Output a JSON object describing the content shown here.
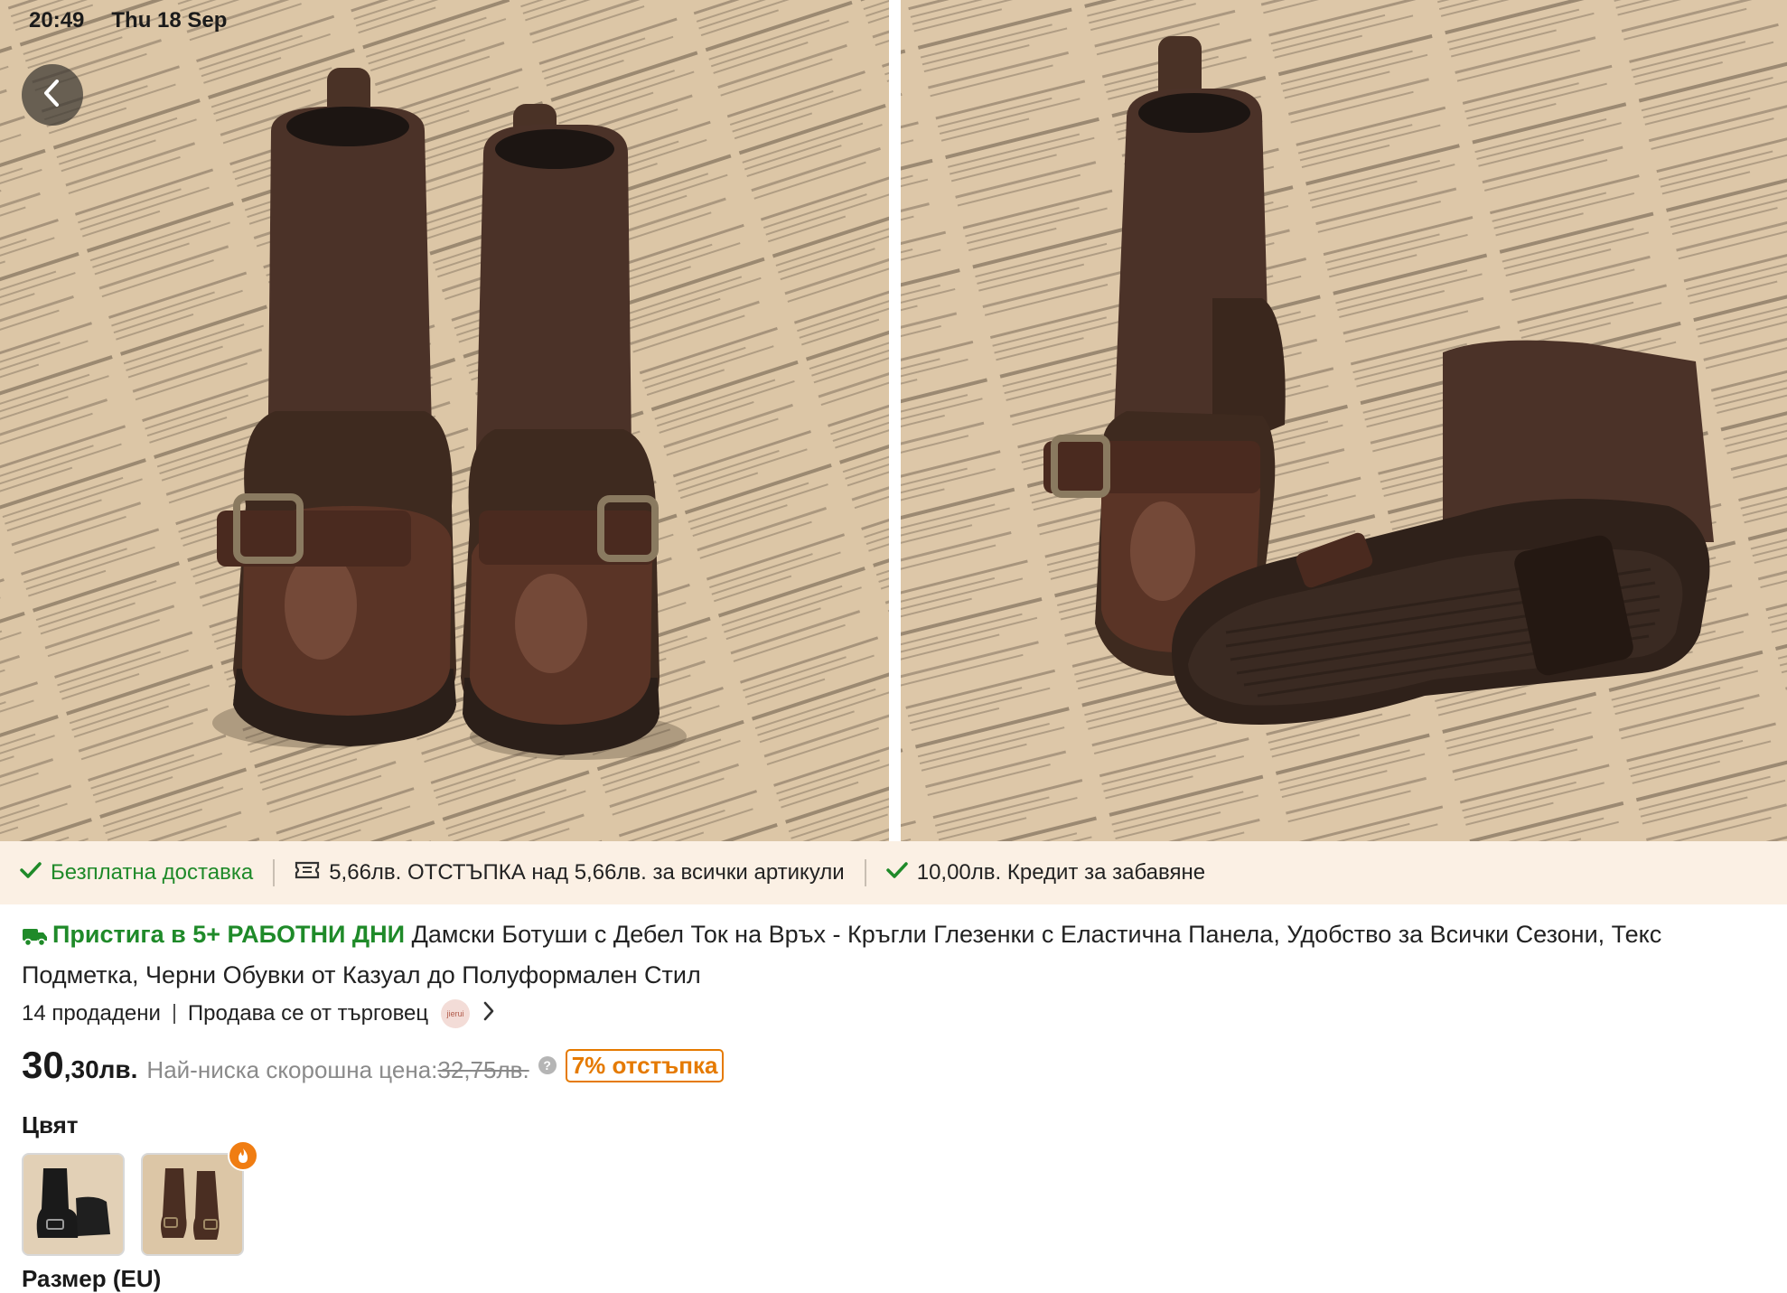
{
  "status_bar": {
    "time": "20:49",
    "date": "Thu 18 Sep"
  },
  "gallery": {
    "images": [
      {
        "alt": "Pair of brown boots, front view"
      },
      {
        "alt": "Brown boots, side and sole view"
      }
    ]
  },
  "promo": {
    "free_shipping": "Безплатна доставка",
    "discount": "5,66лв. ОТСТЪПКА над 5,66лв. за всички артикули",
    "credit": "10,00лв. Кредит за забавяне"
  },
  "product": {
    "delivery_badge": "Пристига в 5+ РАБОТНИ ДНИ",
    "title_line1": "Дамски Ботуши с Дебел Ток на Връх - Кръгли Глезенки с Еластична Панела, Удобство за Всички Сезони, Текс",
    "title_line2": "Подметка, Черни Обувки от Казуал до Полуформален Стил",
    "sold": "14 продадени",
    "seller": "Продава се от търговец",
    "seller_logo_text": "jierui",
    "price_main": "30",
    "price_cents": ",30лв.",
    "lowest_label": "Най-ниска скорошна цена:",
    "old_price": "32,75лв.",
    "info": "?",
    "discount_badge": "7% отстъпка"
  },
  "options": {
    "color_label": "Цвят",
    "colors": [
      "Черен",
      "Кафяв"
    ],
    "size_label": "Размер (EU)"
  },
  "colors": {
    "accent_green": "#1f8a29",
    "discount_orange": "#e57a00",
    "promo_bg": "#fbf0e4"
  }
}
